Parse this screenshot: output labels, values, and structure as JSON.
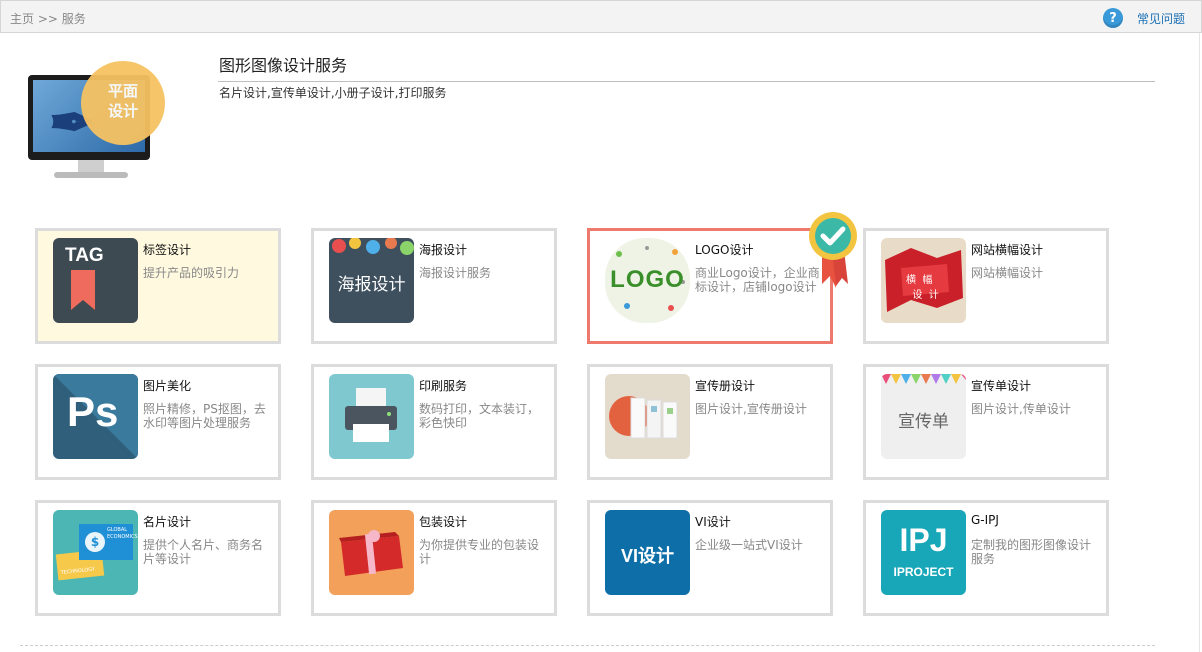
{
  "breadcrumb": {
    "home": "主页",
    "sep": ">>",
    "current": "服务"
  },
  "faq": {
    "icon": "question-icon",
    "label": "常见问题"
  },
  "hero": {
    "badge_line1": "平面",
    "badge_line2": "设计",
    "title": "图形图像设计服务",
    "description": "名片设计,宣传单设计,小册子设计,打印服务"
  },
  "cards": [
    {
      "title": "标签设计",
      "desc": "提升产品的吸引力",
      "thumb_text": "TAG"
    },
    {
      "title": "海报设计",
      "desc": "海报设计服务",
      "thumb_text": "海报设计"
    },
    {
      "title": "LOGO设计",
      "desc": "商业Logo设计，企业商标设计，店铺logo设计",
      "thumb_text": "LOGO"
    },
    {
      "title": "网站横幅设计",
      "desc": "网站横幅设计",
      "thumb_text_1": "横",
      "thumb_text_2": "幅",
      "thumb_text_3": "设",
      "thumb_text_4": "计"
    },
    {
      "title": "图片美化",
      "desc": "照片精修，PS抠图，去水印等图片处理服务",
      "thumb_text": "Ps"
    },
    {
      "title": "印刷服务",
      "desc": "数码打印，文本装订，彩色快印"
    },
    {
      "title": "宣传册设计",
      "desc": "图片设计,宣传册设计"
    },
    {
      "title": "宣传单设计",
      "desc": "图片设计,传单设计",
      "thumb_text": "宣传单"
    },
    {
      "title": "名片设计",
      "desc": "提供个人名片、商务名片等设计",
      "thumb_text_1": "GLOBAL",
      "thumb_text_2": "ECONOMICS",
      "thumb_text_3": "TECHNOLOGY"
    },
    {
      "title": "包装设计",
      "desc": "为你提供专业的包装设计"
    },
    {
      "title": "VI设计",
      "desc": "企业级一站式VI设计",
      "thumb_text": "VI设计"
    },
    {
      "title": "G-IPJ",
      "desc": "定制我的图形图像设计服务",
      "thumb_text_1": "IPJ",
      "thumb_text_2": "IPROJECT"
    }
  ],
  "colors": {
    "selected_border": "#ee7a6e",
    "highlight_bg": "#fff9e0",
    "link": "#1a6fb5"
  }
}
